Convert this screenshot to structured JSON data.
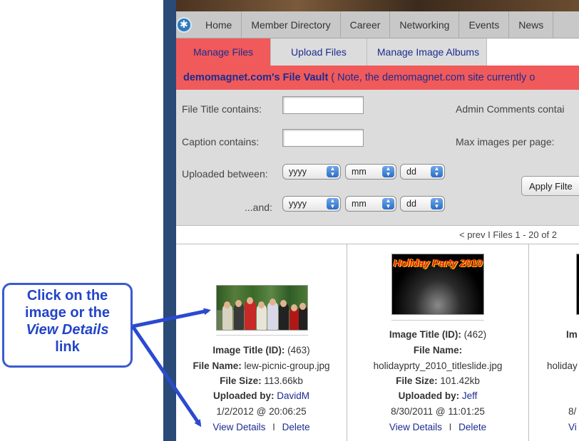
{
  "nav": {
    "items": [
      "Home",
      "Member Directory",
      "Career",
      "Networking",
      "Events",
      "News"
    ]
  },
  "tabs": {
    "manage_files": "Manage Files",
    "upload_files": "Upload Files",
    "manage_albums": "Manage Image Albums"
  },
  "vault": {
    "title": "demomagnet.com's File Vault",
    "note": "( Note, the demomagnet.com site currently o"
  },
  "filters": {
    "file_title_label": "File Title contains:",
    "file_title_value": "",
    "caption_label": "Caption contains:",
    "caption_value": "",
    "admin_comments_label": "Admin Comments contai",
    "max_images_label": "Max images per page:",
    "uploaded_between_label": "Uploaded between:",
    "and_label": "...and:",
    "from": {
      "year": "yyyy",
      "month": "mm",
      "day": "dd"
    },
    "to": {
      "year": "yyyy",
      "month": "mm",
      "day": "dd"
    },
    "apply_label": "Apply Filte"
  },
  "pager": {
    "text": "< prev I Files 1 - 20 of 2"
  },
  "files": [
    {
      "image_title_label": "Image Title (ID):",
      "id": "(463)",
      "file_name_label": "File Name:",
      "file_name": "lew-picnic-group.jpg",
      "file_size_label": "File Size:",
      "file_size": "113.66kb",
      "uploaded_by_label": "Uploaded by:",
      "uploaded_by": "DavidM",
      "date": "1/2/2012 @ 20:06:25",
      "view_details": "View Details",
      "sep": "I",
      "delete": "Delete"
    },
    {
      "image_title_label": "Image Title (ID):",
      "id": "(462)",
      "file_name_label": "File Name:",
      "file_name": "holidayprty_2010_titleslide.jpg",
      "file_size_label": "File Size:",
      "file_size": "101.42kb",
      "uploaded_by_label": "Uploaded by:",
      "uploaded_by": "Jeff",
      "date": "8/30/2011 @ 11:01:25",
      "view_details": "View Details",
      "sep": "I",
      "delete": "Delete",
      "thumb_title": "Holiday Party 2010",
      "thumb_subtitle": ""
    },
    {
      "image_title_label": "Im",
      "file_name_partial": "holiday",
      "date_partial": "8/",
      "view_partial": "Vi"
    }
  ],
  "callout": {
    "line1": "Click on the",
    "line2": "image or the",
    "line3": "View Details",
    "line4": "link"
  },
  "colors": {
    "accent_red": "#f05a5a",
    "link_blue": "#1d2c8f",
    "callout_blue": "#2244c8"
  }
}
